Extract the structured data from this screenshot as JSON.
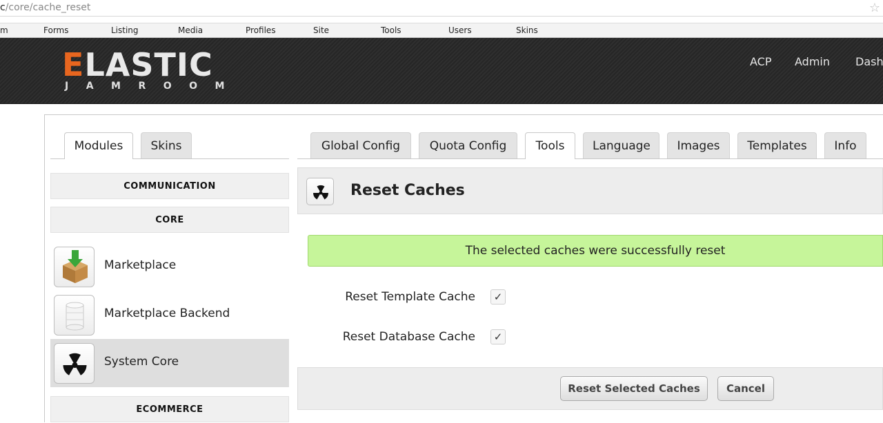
{
  "browser": {
    "url_prefix": "c",
    "url_path": "/core/cache_reset"
  },
  "menu": {
    "items": [
      "m",
      "Forms",
      "Listing",
      "Media",
      "Profiles",
      "Site",
      "Tools",
      "Users",
      "Skins"
    ]
  },
  "header": {
    "logo_main_first": "E",
    "logo_main_rest": "LASTIC",
    "logo_sub": "JAMROOM",
    "nav": [
      "ACP",
      "Admin",
      "Dash"
    ]
  },
  "tabs": {
    "left": [
      "Modules",
      "Skins"
    ],
    "right": [
      "Global Config",
      "Quota Config",
      "Tools",
      "Language",
      "Images",
      "Templates",
      "Info"
    ],
    "active_left": "Modules",
    "active_right": "Tools"
  },
  "sidebar": {
    "categories": [
      "COMMUNICATION",
      "CORE",
      "ECOMMERCE"
    ],
    "items": [
      {
        "label": "Marketplace",
        "icon": "box-download-icon"
      },
      {
        "label": "Marketplace Backend",
        "icon": "database-icon"
      },
      {
        "label": "System Core",
        "icon": "radiation-icon",
        "active": true
      }
    ]
  },
  "content": {
    "title": "Reset Caches",
    "title_icon": "radiation-icon",
    "success_message": "The selected caches were successfully reset",
    "options": [
      {
        "label": "Reset Template Cache",
        "checked": true
      },
      {
        "label": "Reset Database Cache",
        "checked": true
      }
    ],
    "check_mark": "✓",
    "submit_label": "Reset Selected Caches",
    "cancel_label": "Cancel"
  },
  "colors": {
    "accent": "#e8661f",
    "success_bg": "#c6f59a",
    "header_bg": "#2b2b2b"
  }
}
